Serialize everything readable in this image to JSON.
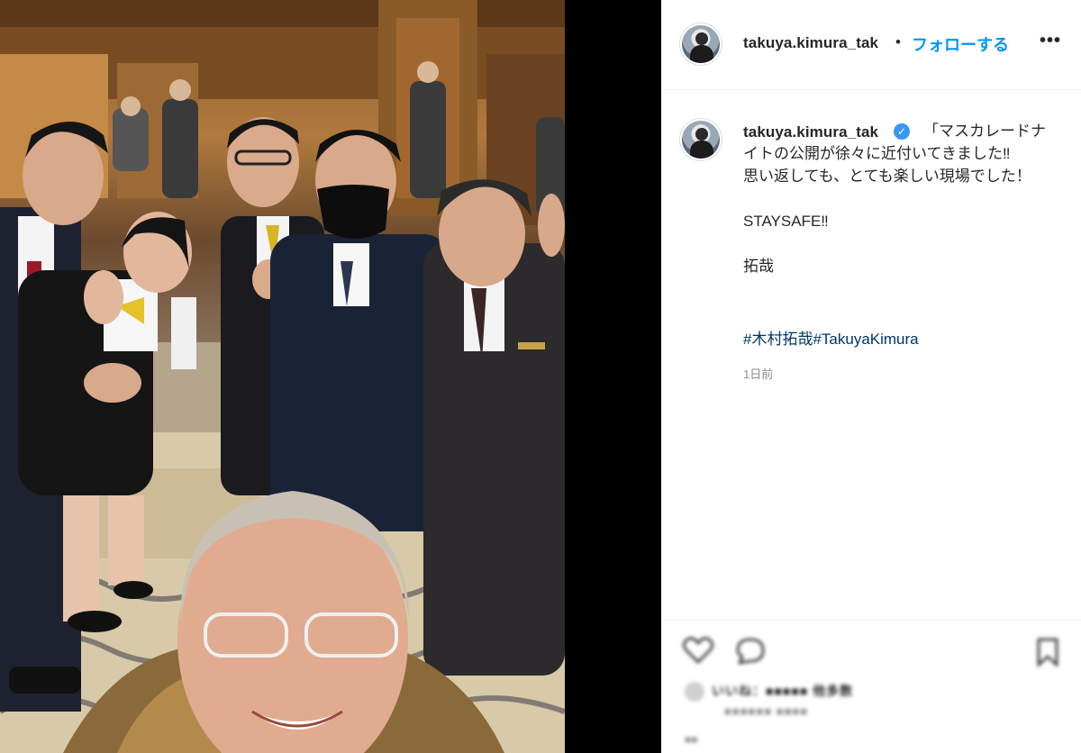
{
  "post": {
    "photo_alt": "",
    "author": {
      "username": "takuya.kimura_tak",
      "verified_icon": "verified-badge-icon",
      "separator": "•",
      "follow_label": "フォローする",
      "more_icon": "more-options-icon",
      "more_glyph": "•••"
    },
    "caption": {
      "username": "takuya.kimura_tak",
      "verified_glyph": "✓",
      "text": "「マスカレードナイトの公開が徐々に近付いてきました‼︎\n思い返しても、とても楽しい現場でした！\n\nSTAYSAFE‼︎\n\n拓哉",
      "hashtags": "#木村拓哉#TakuyaKimura",
      "time": "1日前"
    },
    "actions": {
      "like_icon": "heart-icon",
      "comment_icon": "comment-icon",
      "save_icon": "bookmark-icon",
      "liked_by_text": "いいね：■■■■■ 他多数",
      "liked_sub_text": "■■■■■■ ■■■■",
      "footer_text": "■■"
    },
    "colors": {
      "link_blue": "#0095f6",
      "hashtag_blue": "#00376b",
      "verified_blue": "#3897f0",
      "text": "#262626",
      "muted": "#8e8e8e"
    }
  }
}
